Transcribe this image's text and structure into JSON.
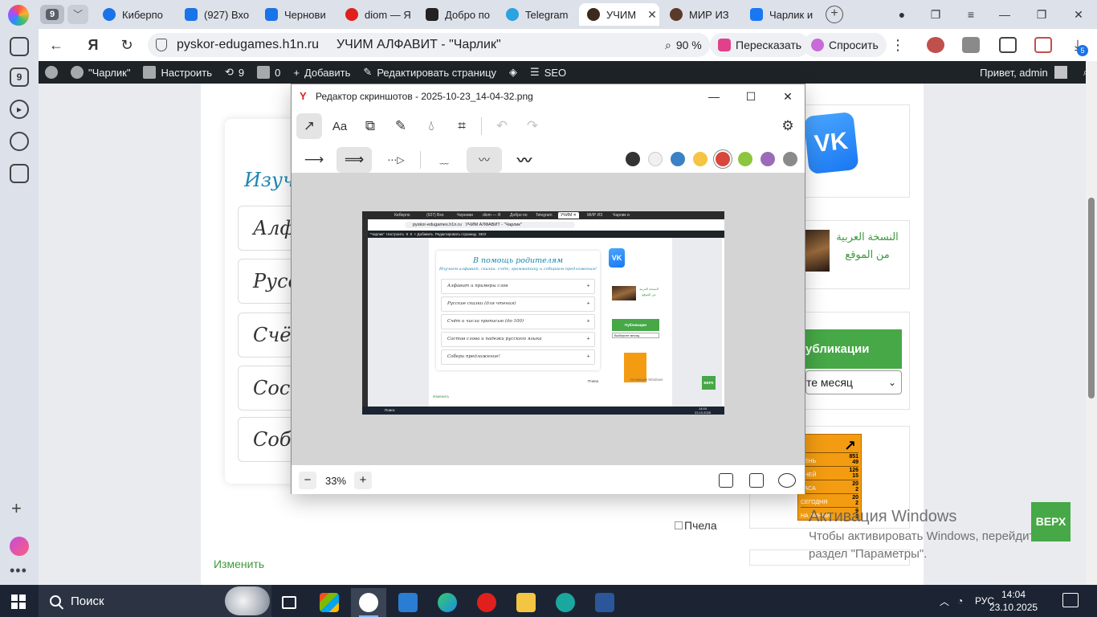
{
  "browser": {
    "tab_count": "9",
    "tabs": [
      {
        "label": "Киберпо",
        "color": "#1a73e8"
      },
      {
        "label": "(927) Вхо",
        "color": "#1a73e8"
      },
      {
        "label": "Чернови",
        "color": "#1a73e8"
      },
      {
        "label": "diom — Я",
        "color": "#e0201c"
      },
      {
        "label": "Добро по",
        "color": "#222222"
      },
      {
        "label": "Telegram",
        "color": "#2aa3df"
      },
      {
        "label": "УЧИМ",
        "color": "#3b2a1d"
      },
      {
        "label": "МИР ИЗ",
        "color": "#5a3a2a"
      },
      {
        "label": "Чарлик и",
        "color": "#1977f3"
      }
    ],
    "active_tab_index": 6,
    "url_domain": "pyskor-edugames.h1n.ru",
    "page_title": "УЧИМ АЛФАВИТ - \"Чарлик\"",
    "zoom_label": "90 %",
    "retell_label": "Пересказать",
    "ask_label": "Спросить",
    "downloads_badge": "5"
  },
  "wp_admin_bar": {
    "site_name": "\"Чарлик\"",
    "customize": "Настроить",
    "updates_count": "9",
    "comments_count": "0",
    "add_new": "Добавить",
    "edit_page": "Редактировать страницу",
    "seo": "SEO",
    "greeting": "Привет, admin"
  },
  "page": {
    "card_subtitle_partial": "Изучаё",
    "accordion_partials": [
      "Алфав",
      "Русски",
      "Счёт и",
      "Состав",
      "Собер"
    ],
    "edit_link": "Изменить",
    "broken_image_alt": "Пчела",
    "arabic_text": "النسخة العربية من الموقع",
    "publications_heading": "убликации",
    "month_select": "те месяц",
    "counter_rows": [
      {
        "label": "ДЕНЬ",
        "v1": "851",
        "v2": "49"
      },
      {
        "label": "ДНЕЙ",
        "v1": "126",
        "v2": "15"
      },
      {
        "label": "ЧАСА",
        "v1": "20",
        "v2": "2"
      },
      {
        "label": "СЕГОДНЯ",
        "v1": "20",
        "v2": "2"
      },
      {
        "label": "НА ЛИНИИ",
        "v1": "9",
        "v2": "1"
      }
    ],
    "activation_title": "Активация Windows",
    "activation_line1": "Чтобы активировать Windows, перейдите в",
    "activation_line2": "раздел \"Параметры\".",
    "top_button": "ВЕРХ"
  },
  "editor": {
    "title": "Редактор скриншотов - 2025-10-23_14-04-32.png",
    "text_tool_label": "Aa",
    "zoom": "33%",
    "colors": [
      "#333333",
      "#f0f0f0",
      "#3b82c4",
      "#f5c542",
      "#d9463b",
      "#8cc63f",
      "#9b6bb8",
      "#8a8a8a"
    ],
    "selected_color_index": 4
  },
  "thumbnail": {
    "url": "pyskor-edugames.h1n.ru",
    "page_title": "УЧИМ АЛФАВИТ - \"Чарлик\"",
    "card_title": "В помощь родителям",
    "card_subtitle": "Изучаем алфавит, сказки, счёт, грамматику и собираем предложения!",
    "accordion": [
      "Алфавит и примеры слов",
      "Русские сказки (для чтения)",
      "Счёт и числа прописью (до 100)",
      "Состав слова и падежи русского языка",
      "Собери предложение!"
    ],
    "publications": "Публикации",
    "select_month": "Выберите месяц",
    "taskbar_search": "Поиск",
    "time": "14:04",
    "date": "23.10.2025"
  },
  "taskbar": {
    "search_placeholder": "Поиск",
    "language": "РУС",
    "time": "14:04",
    "date": "23.10.2025"
  }
}
